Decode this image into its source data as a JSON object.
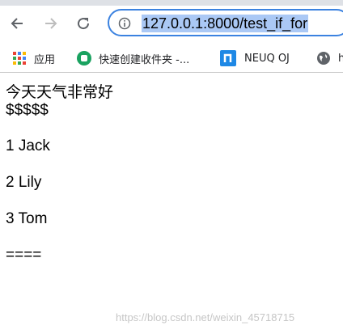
{
  "browser": {
    "url": "127.0.0.1:8000/test_if_for",
    "nav_icons": [
      "back-arrow-icon",
      "forward-arrow-icon",
      "reload-icon",
      "info-icon"
    ],
    "bookmarks": [
      {
        "label": "应用",
        "icon": "apps-grid-icon"
      },
      {
        "label": "快速创建收件夹 -...",
        "icon": "green-circle-icon"
      },
      {
        "label": "NEUQ OJ",
        "icon": "neuq-logo-icon"
      },
      {
        "label": "h",
        "icon": "globe-icon"
      }
    ]
  },
  "page": {
    "weather_line": "今天天气非常好",
    "dollar_line": "$$$$$",
    "items": [
      "1 Jack",
      "2 Lily",
      "3 Tom"
    ],
    "end_line": "===="
  },
  "watermark": "https://blog.csdn.net/weixin_45718715",
  "colors": {
    "omnibox_border": "#3b82e0",
    "url_highlight": "#aac8f5",
    "watermark": "#c6c6c6"
  }
}
